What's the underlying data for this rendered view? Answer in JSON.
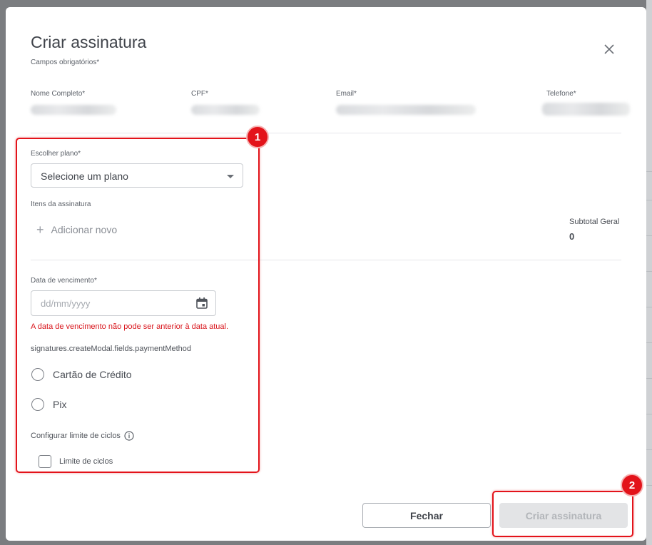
{
  "modal": {
    "title": "Criar assinatura",
    "subtitle": "Campos obrigatórios*"
  },
  "customer": {
    "name_label": "Nome Completo*",
    "cpf_label": "CPF*",
    "email_label": "Email*",
    "phone_label": "Telefone*"
  },
  "plan": {
    "label": "Escolher plano*",
    "selected": "Selecione um plano"
  },
  "items": {
    "label": "Itens da assinatura",
    "add_label": "Adicionar novo",
    "subtotal_label": "Subtotal Geral",
    "subtotal_value": "0"
  },
  "due_date": {
    "label": "Data de vencimento*",
    "placeholder": "dd/mm/yyyy",
    "error": "A data de vencimento não pode ser anterior à data atual."
  },
  "payment": {
    "label": "signatures.createModal.fields.paymentMethod",
    "options": [
      "Cartão de Crédito",
      "Pix"
    ]
  },
  "cycles": {
    "label": "Configurar limite de ciclos",
    "checkbox_label": "Limite de ciclos"
  },
  "footer": {
    "close_label": "Fechar",
    "create_label": "Criar assinatura"
  },
  "annotations": [
    "1",
    "2"
  ],
  "colors": {
    "annotation": "#e3131a",
    "error": "#d9151c",
    "disabled_button_bg": "#e3e4e6"
  }
}
